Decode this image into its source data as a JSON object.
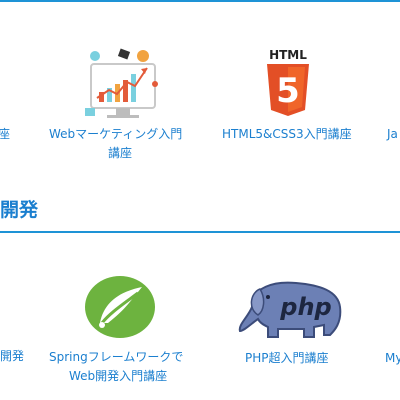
{
  "section1": {
    "cards": [
      {
        "label": "座"
      },
      {
        "label_line1": "Webマーケティング入門",
        "label_line2": "講座"
      },
      {
        "label": "HTML5&CSS3入門講座",
        "logo_text": "HTML",
        "logo_number": "5"
      },
      {
        "label": "Ja"
      }
    ]
  },
  "section2": {
    "heading": "開発",
    "cards": [
      {
        "label": "開発"
      },
      {
        "label_line1": "Springフレームワークで",
        "label_line2": "Web開発入門講座"
      },
      {
        "label": "PHP超入門講座",
        "logo_text": "php"
      },
      {
        "label": "My"
      }
    ]
  },
  "colors": {
    "accent": "#1b7fcf",
    "rule": "#1e93d6",
    "html5_orange": "#e34f26",
    "spring_green": "#6db33f",
    "php_blue": "#6c80b5"
  }
}
